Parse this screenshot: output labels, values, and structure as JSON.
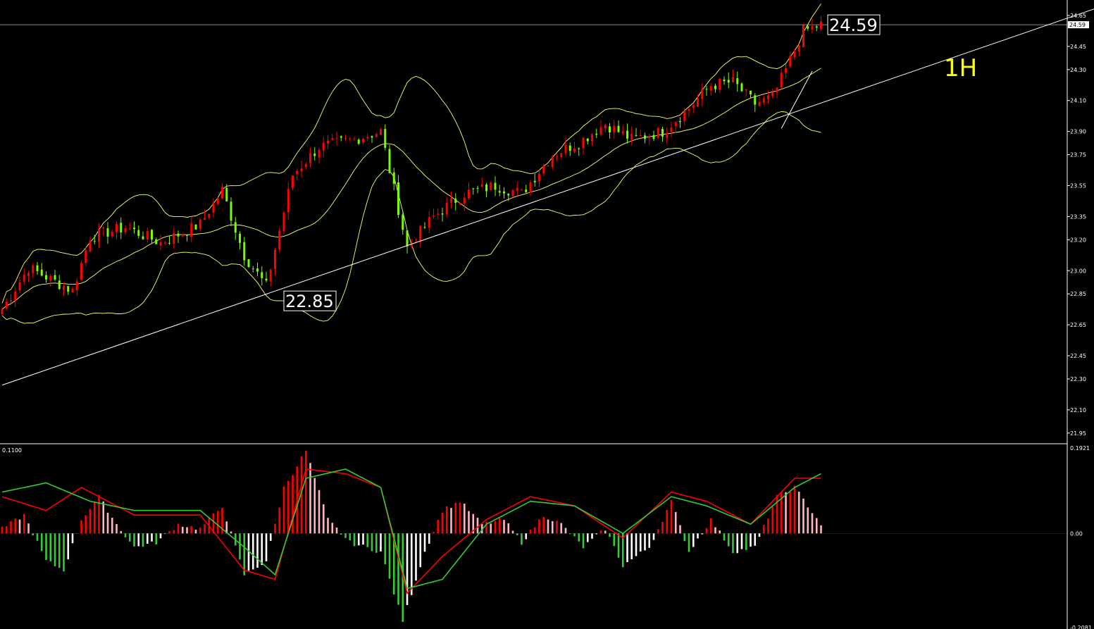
{
  "chart_data": [
    {
      "type": "candlestick",
      "panel": "price",
      "timeframe_label": "1H",
      "current_price": 24.59,
      "annotations": [
        {
          "label": "22.85",
          "price": 22.85
        },
        {
          "label": "24.59",
          "price": 24.59
        }
      ],
      "y_ticks": [
        "24.65",
        "24.45",
        "24.30",
        "24.10",
        "23.90",
        "23.75",
        "23.55",
        "23.35",
        "23.20",
        "23.00",
        "22.85",
        "22.65",
        "22.45",
        "22.30",
        "22.10",
        "21.95"
      ],
      "ylim": [
        21.89,
        24.75
      ],
      "grid": false,
      "trendlines": [
        {
          "from_bar": 0,
          "from_price": 22.26,
          "to_bar": 258,
          "to_price": 24.79
        },
        {
          "from_bar": 177,
          "from_price": 23.92,
          "to_bar": 184,
          "to_price": 24.29
        }
      ],
      "bollinger_bands": true,
      "bar_count": 179,
      "colors": {
        "up": "#ff0000",
        "down": "#7cfc00",
        "bands": "#ffff66",
        "trendline": "#ffffff"
      },
      "key_levels": [
        {
          "bar": 0,
          "close": 22.75
        },
        {
          "bar": 6,
          "close": 23.02
        },
        {
          "bar": 16,
          "close": 22.87
        },
        {
          "bar": 20,
          "close": 23.22
        },
        {
          "bar": 28,
          "close": 23.28
        },
        {
          "bar": 36,
          "close": 23.18
        },
        {
          "bar": 45,
          "close": 23.3
        },
        {
          "bar": 50,
          "close": 23.52
        },
        {
          "bar": 55,
          "close": 23.1
        },
        {
          "bar": 60,
          "close": 22.9
        },
        {
          "bar": 66,
          "close": 23.62
        },
        {
          "bar": 72,
          "close": 23.8
        },
        {
          "bar": 80,
          "close": 23.85
        },
        {
          "bar": 86,
          "close": 23.9
        },
        {
          "bar": 92,
          "close": 23.15
        },
        {
          "bar": 98,
          "close": 23.35
        },
        {
          "bar": 105,
          "close": 23.5
        },
        {
          "bar": 112,
          "close": 23.55
        },
        {
          "bar": 118,
          "close": 23.5
        },
        {
          "bar": 125,
          "close": 23.75
        },
        {
          "bar": 131,
          "close": 23.83
        },
        {
          "bar": 137,
          "close": 23.95
        },
        {
          "bar": 143,
          "close": 23.85
        },
        {
          "bar": 150,
          "close": 23.9
        },
        {
          "bar": 156,
          "close": 24.05
        },
        {
          "bar": 161,
          "close": 24.2
        },
        {
          "bar": 166,
          "close": 24.22
        },
        {
          "bar": 171,
          "close": 24.08
        },
        {
          "bar": 175,
          "close": 24.12
        },
        {
          "bar": 178,
          "close": 24.3
        },
        {
          "bar": 182,
          "close": 24.55
        },
        {
          "bar": 186,
          "close": 24.59
        }
      ]
    },
    {
      "type": "histogram",
      "panel": "macd",
      "y_ticks": [
        "0.1921",
        "0.00",
        "-0.2081"
      ],
      "top_left_label": "0.1100",
      "ylim": [
        -0.2081,
        0.1921
      ],
      "colors": {
        "pos_rising": "#ff0000",
        "pos_falling": "#ffb6c1",
        "neg_falling": "#32cd32",
        "neg_rising": "#ffffff",
        "line1": "#ff0000",
        "line2": "#32cd32"
      },
      "key_values": [
        {
          "bar": 0,
          "value": 0.01
        },
        {
          "bar": 5,
          "value": 0.04
        },
        {
          "bar": 10,
          "value": -0.06
        },
        {
          "bar": 14,
          "value": -0.08
        },
        {
          "bar": 18,
          "value": 0.03
        },
        {
          "bar": 22,
          "value": 0.08
        },
        {
          "bar": 26,
          "value": 0.02
        },
        {
          "bar": 30,
          "value": -0.03
        },
        {
          "bar": 35,
          "value": -0.02
        },
        {
          "bar": 40,
          "value": 0.02
        },
        {
          "bar": 45,
          "value": 0.01
        },
        {
          "bar": 50,
          "value": 0.06
        },
        {
          "bar": 55,
          "value": -0.09
        },
        {
          "bar": 60,
          "value": -0.06
        },
        {
          "bar": 64,
          "value": 0.1
        },
        {
          "bar": 69,
          "value": 0.18
        },
        {
          "bar": 74,
          "value": 0.03
        },
        {
          "bar": 79,
          "value": -0.02
        },
        {
          "bar": 86,
          "value": -0.04
        },
        {
          "bar": 91,
          "value": -0.19
        },
        {
          "bar": 96,
          "value": -0.04
        },
        {
          "bar": 100,
          "value": 0.05
        },
        {
          "bar": 104,
          "value": 0.07
        },
        {
          "bar": 109,
          "value": 0.02
        },
        {
          "bar": 114,
          "value": 0.03
        },
        {
          "bar": 118,
          "value": -0.02
        },
        {
          "bar": 123,
          "value": 0.04
        },
        {
          "bar": 127,
          "value": 0.02
        },
        {
          "bar": 132,
          "value": -0.03
        },
        {
          "bar": 137,
          "value": 0.01
        },
        {
          "bar": 141,
          "value": -0.07
        },
        {
          "bar": 147,
          "value": -0.03
        },
        {
          "bar": 152,
          "value": 0.07
        },
        {
          "bar": 156,
          "value": -0.04
        },
        {
          "bar": 161,
          "value": 0.03
        },
        {
          "bar": 166,
          "value": -0.04
        },
        {
          "bar": 171,
          "value": -0.03
        },
        {
          "bar": 176,
          "value": 0.08
        },
        {
          "bar": 180,
          "value": 0.1
        },
        {
          "bar": 186,
          "value": 0.02
        }
      ],
      "signal_lines": [
        {
          "name": "",
          "values_at": [
            [
              0,
              0.08
            ],
            [
              10,
              0.05
            ],
            [
              18,
              0.1
            ],
            [
              30,
              0.04
            ],
            [
              45,
              0.04
            ],
            [
              55,
              -0.08
            ],
            [
              62,
              -0.1
            ],
            [
              69,
              0.14
            ],
            [
              78,
              0.13
            ],
            [
              86,
              0.1
            ],
            [
              92,
              -0.13
            ],
            [
              100,
              -0.05
            ],
            [
              110,
              0.03
            ],
            [
              120,
              0.08
            ],
            [
              130,
              0.06
            ],
            [
              141,
              -0.01
            ],
            [
              152,
              0.09
            ],
            [
              160,
              0.07
            ],
            [
              170,
              0.02
            ],
            [
              180,
              0.12
            ],
            [
              186,
              0.12
            ]
          ]
        },
        {
          "name": "",
          "values_at": [
            [
              0,
              0.09
            ],
            [
              10,
              0.11
            ],
            [
              20,
              0.07
            ],
            [
              30,
              0.05
            ],
            [
              45,
              0.05
            ],
            [
              55,
              -0.03
            ],
            [
              62,
              -0.09
            ],
            [
              69,
              0.12
            ],
            [
              78,
              0.14
            ],
            [
              86,
              0.1
            ],
            [
              92,
              -0.12
            ],
            [
              100,
              -0.1
            ],
            [
              110,
              0.02
            ],
            [
              120,
              0.07
            ],
            [
              130,
              0.06
            ],
            [
              141,
              0.0
            ],
            [
              152,
              0.08
            ],
            [
              160,
              0.06
            ],
            [
              170,
              0.02
            ],
            [
              180,
              0.1
            ],
            [
              186,
              0.13
            ]
          ]
        }
      ]
    }
  ]
}
